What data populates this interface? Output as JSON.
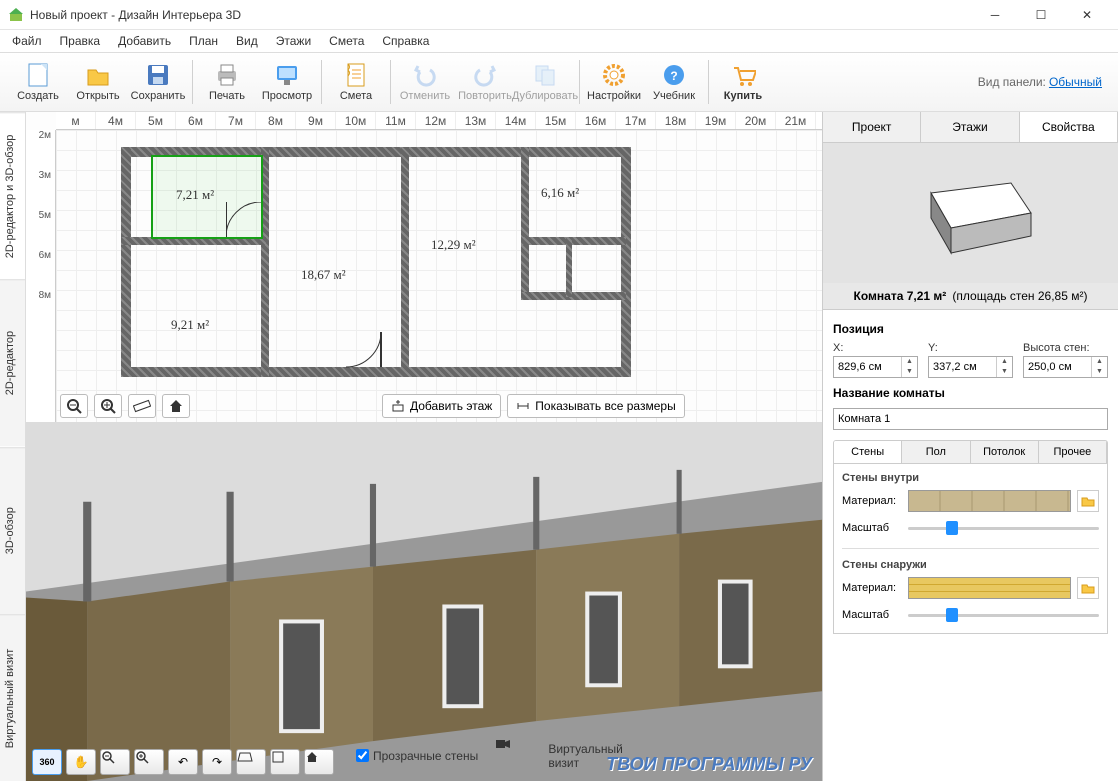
{
  "title": "Новый проект - Дизайн Интерьера 3D",
  "menu": [
    "Файл",
    "Правка",
    "Добавить",
    "План",
    "Вид",
    "Этажи",
    "Смета",
    "Справка"
  ],
  "toolbar": {
    "create": "Создать",
    "open": "Открыть",
    "save": "Сохранить",
    "print": "Печать",
    "preview": "Просмотр",
    "estimate": "Смета",
    "undo": "Отменить",
    "redo": "Повторить",
    "duplicate": "Дублировать",
    "settings": "Настройки",
    "tutorial": "Учебник",
    "buy": "Купить"
  },
  "panel_label": "Вид панели:",
  "panel_value": "Обычный",
  "vtabs": [
    "2D-редактор и 3D-обзор",
    "2D-редактор",
    "3D-обзор",
    "Виртуальный визит"
  ],
  "rulers_h": [
    "м",
    "4м",
    "5м",
    "6м",
    "7м",
    "8м",
    "9м",
    "10м",
    "11м",
    "12м",
    "13м",
    "14м",
    "15м",
    "16м",
    "17м",
    "18м",
    "19м",
    "20м",
    "21м"
  ],
  "rulers_v": [
    "2м",
    "3м",
    "5м",
    "6м",
    "8м"
  ],
  "rooms": [
    {
      "area": "7,21 м²"
    },
    {
      "area": "6,16 м²"
    },
    {
      "area": "12,29 м²"
    },
    {
      "area": "18,67 м²"
    },
    {
      "area": "9,21 м²"
    }
  ],
  "plan_btns": {
    "add_floor": "Добавить этаж",
    "show_dims": "Показывать все размеры"
  },
  "bottom": {
    "transparent": "Прозрачные стены",
    "virtual": "Виртуальный визит"
  },
  "watermark": "ТВОИ ПРОГРАММЫ РУ",
  "sidebar": {
    "tabs": [
      "Проект",
      "Этажи",
      "Свойства"
    ],
    "room_info_a": "Комната 7,21 м²",
    "room_info_b": "(площадь стен 26,85 м²)",
    "position": "Позиция",
    "x_lbl": "X:",
    "y_lbl": "Y:",
    "h_lbl": "Высота стен:",
    "x": "829,6 см",
    "y": "337,2 см",
    "h": "250,0 см",
    "name_title": "Название комнаты",
    "name": "Комната 1",
    "subtabs": [
      "Стены",
      "Пол",
      "Потолок",
      "Прочее"
    ],
    "inside": "Стены внутри",
    "outside": "Стены снаружи",
    "material": "Материал:",
    "scale": "Масштаб"
  }
}
